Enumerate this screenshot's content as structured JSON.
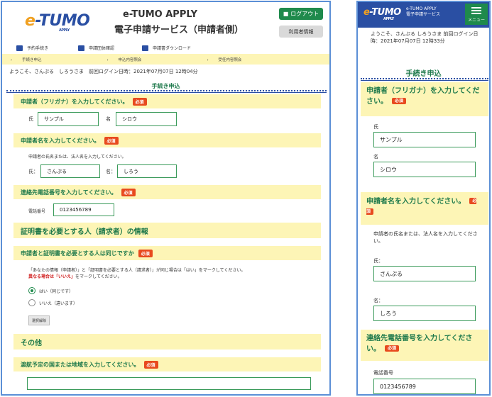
{
  "logo": {
    "e": "e",
    "rest": "-TUMO",
    "sub": "APPLY"
  },
  "desktop": {
    "title_line1": "e-TUMO APPLY",
    "title_line2": "電子申請サービス（申請者側）",
    "logout_label": "ログアウト",
    "userinfo_label": "利用者情報",
    "nav": [
      "予約手続き",
      "申請団体確認",
      "申請書ダウンロード"
    ],
    "breadcrumbs": [
      "手続き申込",
      "申込内容照会",
      "受任内容照会"
    ],
    "welcome": "ようこそ、さんぷる　しろうさま　前回ログイン日時：2021年07月07日 12時04分",
    "section_title": "手続き申込",
    "required_label": "必須",
    "q_furigana": "申請者（フリガナ）を入力してください。",
    "surname_label": "氏",
    "given_label": "名",
    "surname_kana": "サンプル",
    "given_kana": "シロウ",
    "q_name": "申請者名を入力してください。",
    "name_note": "申請者の氏名または、法人名を入力してください。",
    "surname_label2": "氏：",
    "given_label2": "名：",
    "surname": "さんぷる",
    "given": "しろう",
    "q_phone": "連絡先電話番号を入力してください。",
    "phone_label": "電話番号",
    "phone": "0123456789",
    "cert_heading": "証明書を必要とする人（請求者）の情報",
    "q_same": "申請者と証明書を必要とする人は同じですか",
    "same_note1": "「あなたの情報（申請者）」と「証明書を必要とする人（請求者）」が同じ場合は「はい」をマークしてください。",
    "same_note2_bold": "異なる場合は「いいえ」",
    "same_note2_rest": "をマークしてください。",
    "radio_yes": "はい（同じです）",
    "radio_no": "いいえ（違います）",
    "clear_label": "選択解除",
    "other_heading": "その他",
    "q_country": "渡航予定の国または地域を入力してください。"
  },
  "mobile": {
    "title_line1": "e-TUMO APPLY",
    "title_line2": "電子申請サービス",
    "menu_label": "メニュー",
    "welcome": "ようこそ、さんぷる しろうさま 前回ログイン日時：2021年07月07日 12時33分",
    "section_title": "手続き申込",
    "q_furigana": "申請者（フリガナ）を入力してください。",
    "surname_label": "氏",
    "surname_kana": "サンプル",
    "given_label": "名",
    "given_kana": "シロウ",
    "q_name": "申請者名を入力してください。",
    "name_note": "申請者の氏名または、法人名を入力してください。",
    "surname_label2": "氏：",
    "surname": "さんぷる",
    "given_label2": "名：",
    "given": "しろう",
    "q_phone": "連絡先電話番号を入力してください。",
    "phone_label": "電話番号",
    "phone": "0123456789",
    "required_label": "必須"
  },
  "colors": {
    "accent_green": "#1f8a4c",
    "brand_blue": "#2a4fa3",
    "question_bg": "#fdf5b6",
    "required": "#e84a1e"
  }
}
